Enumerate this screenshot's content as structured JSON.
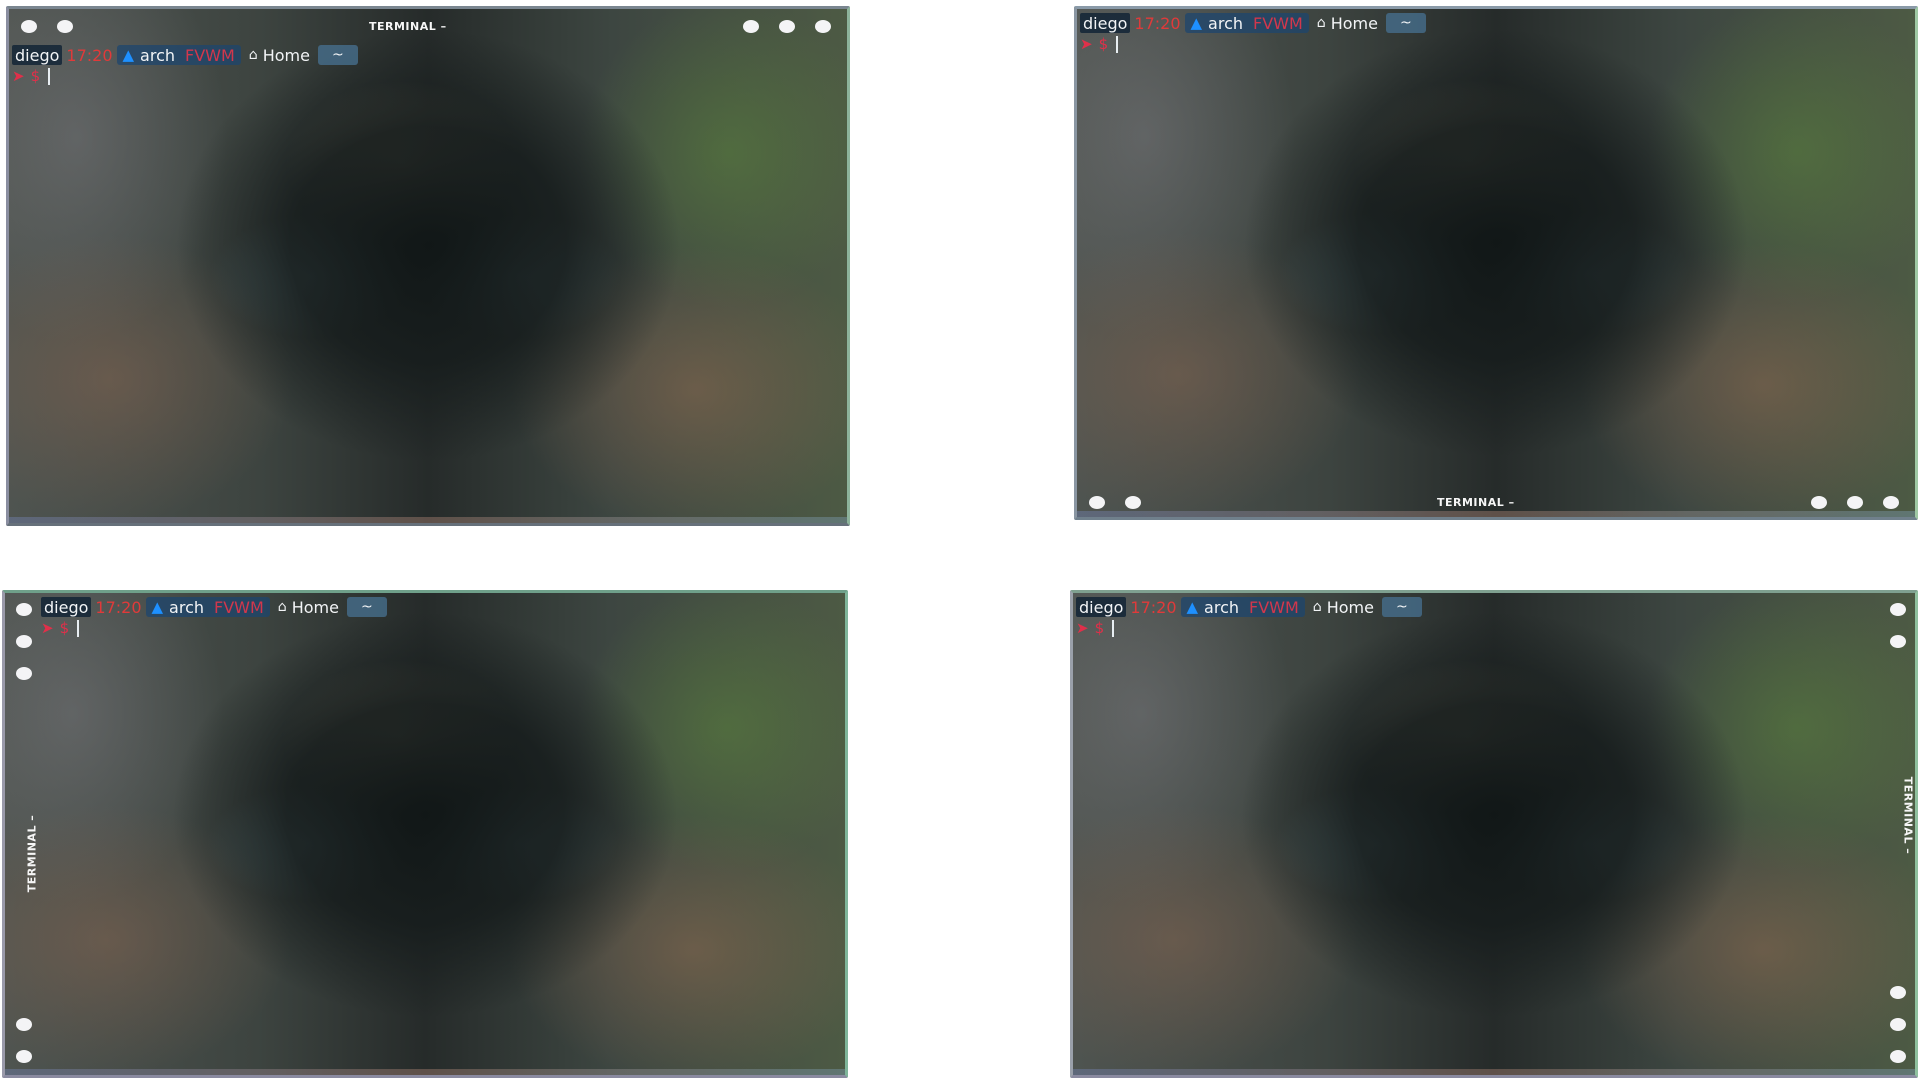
{
  "windows": [
    {
      "title": "TERMINAL –",
      "prompt": {
        "user": "diego",
        "time": "17:20",
        "os_icon": "arch-linux-icon",
        "os": "arch",
        "wm": "FVWM",
        "home_icon": "home-icon",
        "dir": "Home",
        "path": "~",
        "arrow_icon": "arrow-right-icon",
        "symbol": "$"
      }
    },
    {
      "title": "TERMINAL –",
      "prompt": {
        "user": "diego",
        "time": "17:20",
        "os_icon": "arch-linux-icon",
        "os": "arch",
        "wm": "FVWM",
        "home_icon": "home-icon",
        "dir": "Home",
        "path": "~",
        "arrow_icon": "arrow-right-icon",
        "symbol": "$"
      }
    },
    {
      "title": "TERMINAL –",
      "prompt": {
        "user": "diego",
        "time": "17:20",
        "os_icon": "arch-linux-icon",
        "os": "arch",
        "wm": "FVWM",
        "home_icon": "home-icon",
        "dir": "Home",
        "path": "~",
        "arrow_icon": "arrow-right-icon",
        "symbol": "$"
      }
    },
    {
      "title": "TERMINAL –",
      "prompt": {
        "user": "diego",
        "time": "17:20",
        "os_icon": "arch-linux-icon",
        "os": "arch",
        "wm": "FVWM",
        "home_icon": "home-icon",
        "dir": "Home",
        "path": "~",
        "arrow_icon": "arrow-right-icon",
        "symbol": "$"
      }
    }
  ],
  "colors": {
    "time": "#e03a3a",
    "wm": "#d2374c",
    "os_icon": "#1e90ff",
    "prompt_symbol": "#e0304a",
    "title_buttons": "#f4f4f6"
  }
}
